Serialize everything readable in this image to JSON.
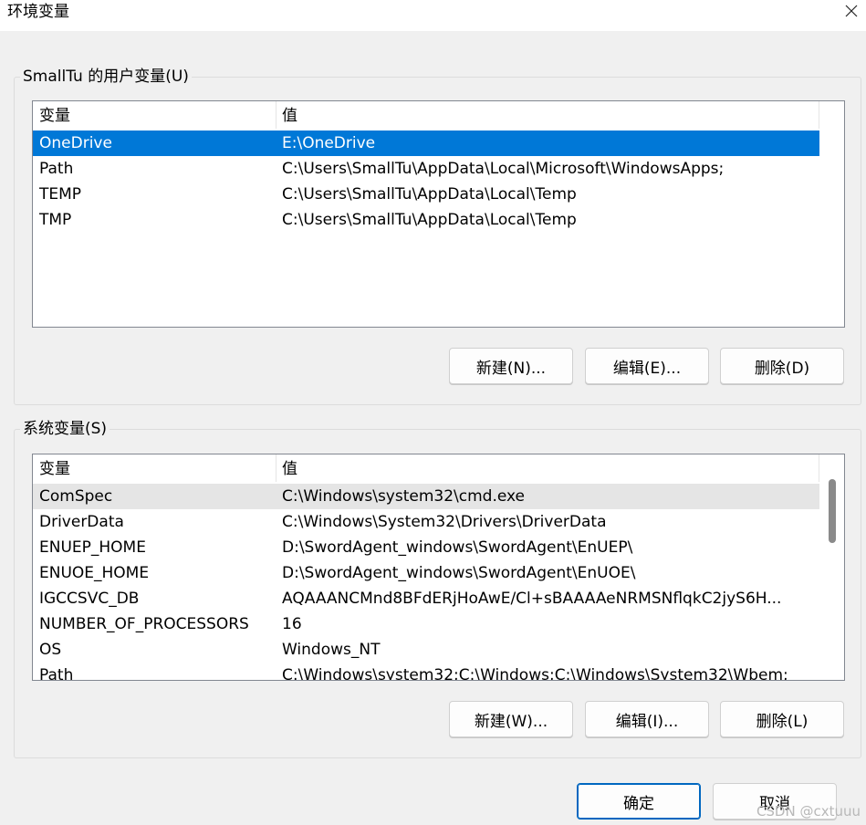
{
  "window": {
    "title": "环境变量",
    "close_icon": "close-icon"
  },
  "user_vars": {
    "group_label": "SmallTu 的用户变量(U)",
    "columns": [
      "变量",
      "值"
    ],
    "rows": [
      {
        "name": "OneDrive",
        "value": "E:\\OneDrive",
        "selected": true
      },
      {
        "name": "Path",
        "value": "C:\\Users\\SmallTu\\AppData\\Local\\Microsoft\\WindowsApps;"
      },
      {
        "name": "TEMP",
        "value": "C:\\Users\\SmallTu\\AppData\\Local\\Temp"
      },
      {
        "name": "TMP",
        "value": "C:\\Users\\SmallTu\\AppData\\Local\\Temp"
      }
    ],
    "buttons": {
      "new": "新建(N)...",
      "edit": "编辑(E)...",
      "delete": "删除(D)"
    }
  },
  "system_vars": {
    "group_label": "系统变量(S)",
    "columns": [
      "变量",
      "值"
    ],
    "rows": [
      {
        "name": "ComSpec",
        "value": "C:\\Windows\\system32\\cmd.exe",
        "hover": true
      },
      {
        "name": "DriverData",
        "value": "C:\\Windows\\System32\\Drivers\\DriverData"
      },
      {
        "name": "ENUEP_HOME",
        "value": "D:\\SwordAgent_windows\\SwordAgent\\EnUEP\\"
      },
      {
        "name": "ENUOE_HOME",
        "value": "D:\\SwordAgent_windows\\SwordAgent\\EnUOE\\"
      },
      {
        "name": "IGCCSVC_DB",
        "value": "AQAAANCMnd8BFdERjHoAwE/Cl+sBAAAAeNRMSNflqkC2jyS6H..."
      },
      {
        "name": "NUMBER_OF_PROCESSORS",
        "value": "16"
      },
      {
        "name": "OS",
        "value": "Windows_NT"
      },
      {
        "name": "Path",
        "value": "C:\\Windows\\system32;C:\\Windows;C:\\Windows\\System32\\Wbem;"
      }
    ],
    "buttons": {
      "new": "新建(W)...",
      "edit": "编辑(I)...",
      "delete": "删除(L)"
    }
  },
  "footer": {
    "ok": "确定",
    "cancel": "取消"
  },
  "watermark": "CSDN @cxtuuu",
  "colors": {
    "selection": "#0078d7",
    "primary_border": "#0067c0"
  }
}
